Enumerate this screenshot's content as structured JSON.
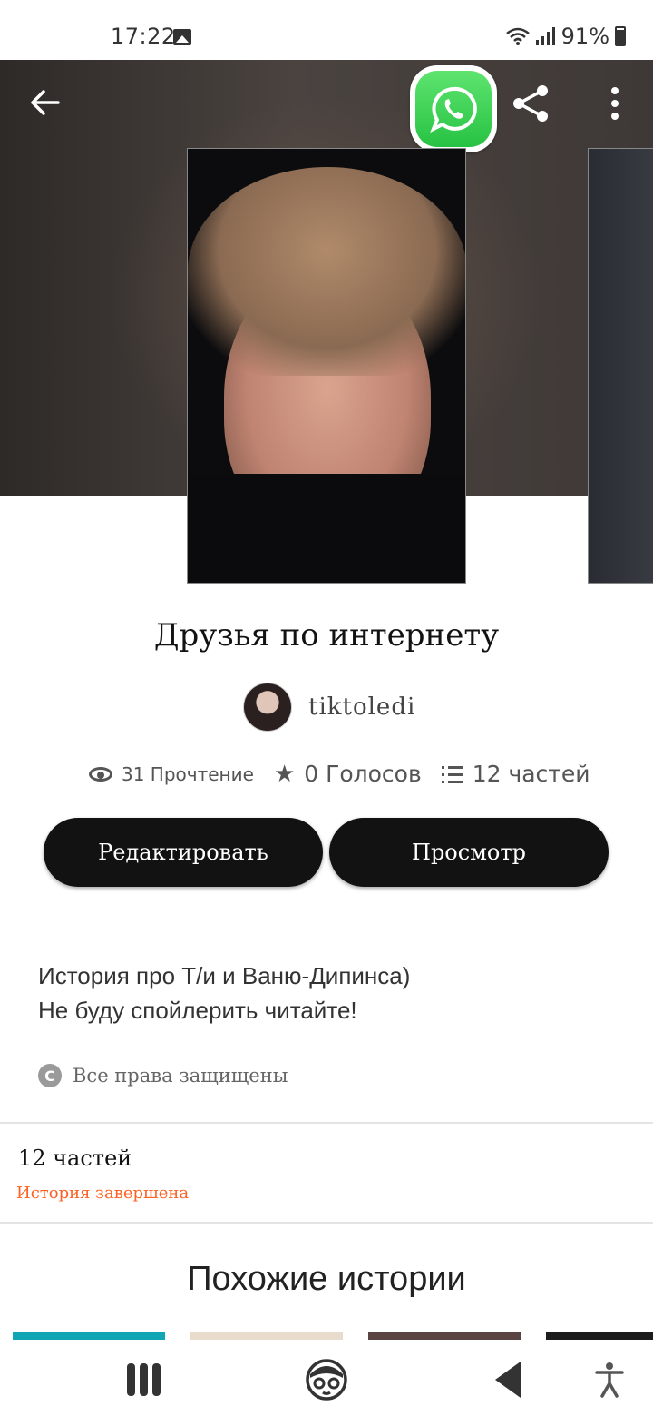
{
  "status_bar": {
    "time": "17:22",
    "battery": "91%",
    "icons": [
      "image-icon",
      "wifi-icon",
      "signal-icon",
      "battery-icon"
    ]
  },
  "header": {
    "icons": [
      "back-arrow-icon",
      "whatsapp-icon",
      "share-icon",
      "more-vert-icon"
    ]
  },
  "story": {
    "title": "Друзья по интернету",
    "author": "tiktoledi",
    "stats": {
      "reads": "31 Прочтение",
      "votes": "0 Голосов",
      "parts": "12 частей"
    },
    "buttons": {
      "edit": "Редактировать",
      "view": "Просмотр"
    },
    "description_lines": [
      "История про Т/и и Ваню-Дипинса)",
      "Не буду спойлерить читайте!"
    ],
    "copyright": "Все права защищены"
  },
  "parts_section": {
    "title": "12 частей",
    "status": "История завершена"
  },
  "similar": {
    "title": "Похожие истории"
  },
  "colors": {
    "button_bg": "#121212",
    "status_orange": "#ff6122",
    "whatsapp_green": "#27c243"
  }
}
